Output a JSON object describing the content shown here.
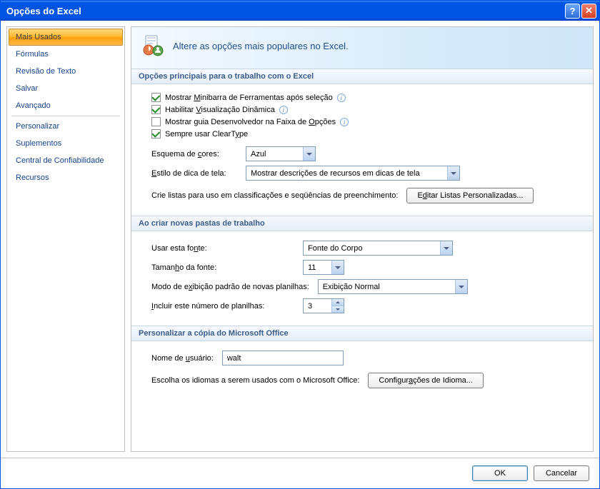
{
  "window": {
    "title": "Opções do Excel"
  },
  "sidebar": {
    "items": [
      {
        "label": "Mais Usados",
        "selected": true
      },
      {
        "label": "Fórmulas"
      },
      {
        "label": "Revisão de Texto"
      },
      {
        "label": "Salvar"
      },
      {
        "label": "Avançado"
      },
      {
        "sep": true
      },
      {
        "label": "Personalizar"
      },
      {
        "label": "Suplementos"
      },
      {
        "label": "Central de Confiabilidade"
      },
      {
        "label": "Recursos"
      }
    ]
  },
  "banner": {
    "text": "Altere as opções mais populares no Excel."
  },
  "sections": {
    "main": {
      "title": "Opções principais para o trabalho com o Excel",
      "chk_minibar": {
        "checked": true,
        "label": "Mostrar Minibarra de Ferramentas após seleção",
        "info": true
      },
      "chk_live": {
        "checked": true,
        "label": "Habilitar Visualização Dinâmica",
        "info": true
      },
      "chk_dev": {
        "checked": false,
        "label": "Mostrar guia Desenvolvedor na Faixa de Opções",
        "info": true
      },
      "chk_cleartype": {
        "checked": true,
        "label": "Sempre usar ClearType"
      },
      "color_scheme_label": "Esquema de cores:",
      "color_scheme_value": "Azul",
      "screentip_label": "Estilo de dica de tela:",
      "screentip_value": "Mostrar descrições de recursos em dicas de tela",
      "lists_text": "Crie listas para uso em classificações e seqüências de preenchimento:",
      "lists_button": "Editar Listas Personalizadas..."
    },
    "newwb": {
      "title": "Ao criar novas pastas de trabalho",
      "font_label": "Usar esta fonte:",
      "font_value": "Fonte do Corpo",
      "fontsize_label": "Tamanho da fonte:",
      "fontsize_value": "11",
      "view_label": "Modo de exibição padrão de novas planilhas:",
      "view_value": "Exibição Normal",
      "sheets_label": "Incluir este número de planilhas:",
      "sheets_value": "3"
    },
    "personalize": {
      "title": "Personalizar a cópia do Microsoft Office",
      "username_label": "Nome de usuário:",
      "username_value": "walt",
      "lang_text": "Escolha os idiomas a serem usados com o Microsoft Office:",
      "lang_button": "Configurações de Idioma..."
    }
  },
  "footer": {
    "ok": "OK",
    "cancel": "Cancelar"
  }
}
